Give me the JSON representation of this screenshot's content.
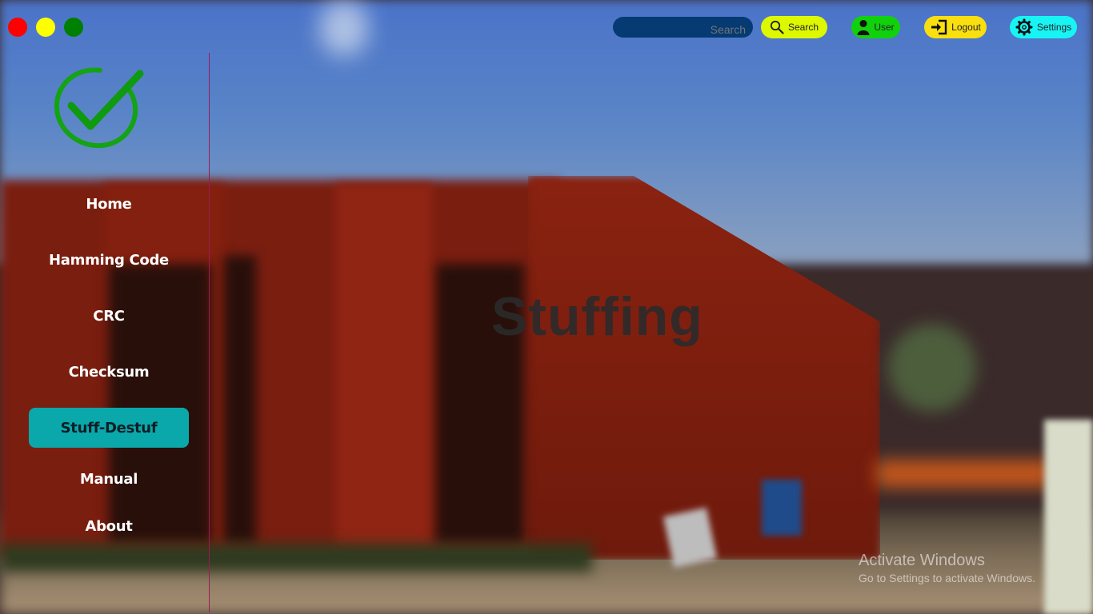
{
  "window_controls": [
    "close",
    "minimize",
    "maximize"
  ],
  "topbar": {
    "search_placeholder": "Search",
    "search_button": "Search",
    "user_button": "User",
    "logout_button": "Logout",
    "settings_button": "Settings"
  },
  "sidebar": {
    "items": [
      {
        "label": "Home",
        "active": false
      },
      {
        "label": "Hamming Code",
        "active": false
      },
      {
        "label": "CRC",
        "active": false
      },
      {
        "label": "Checksum",
        "active": false
      },
      {
        "label": "Stuff-Destuf",
        "active": true
      },
      {
        "label": "Manual",
        "active": false
      },
      {
        "label": "About",
        "active": false
      }
    ]
  },
  "main": {
    "title": "Stuffing"
  },
  "watermark": {
    "title": "Activate Windows",
    "subtitle": "Go to Settings to activate Windows."
  },
  "colors": {
    "active_nav": "#0aa8aa",
    "search_bg": "#053a72",
    "search_button": "#ddf800",
    "user_button": "#11d10c",
    "logout_button": "#f9df10",
    "settings_button": "#18f4f4",
    "divider": "#9b1a55"
  },
  "icons": {
    "logo": "checkmark-logo-icon",
    "search": "magnifier-icon",
    "user": "user-icon",
    "logout": "logout-icon",
    "settings": "gear-icon"
  }
}
